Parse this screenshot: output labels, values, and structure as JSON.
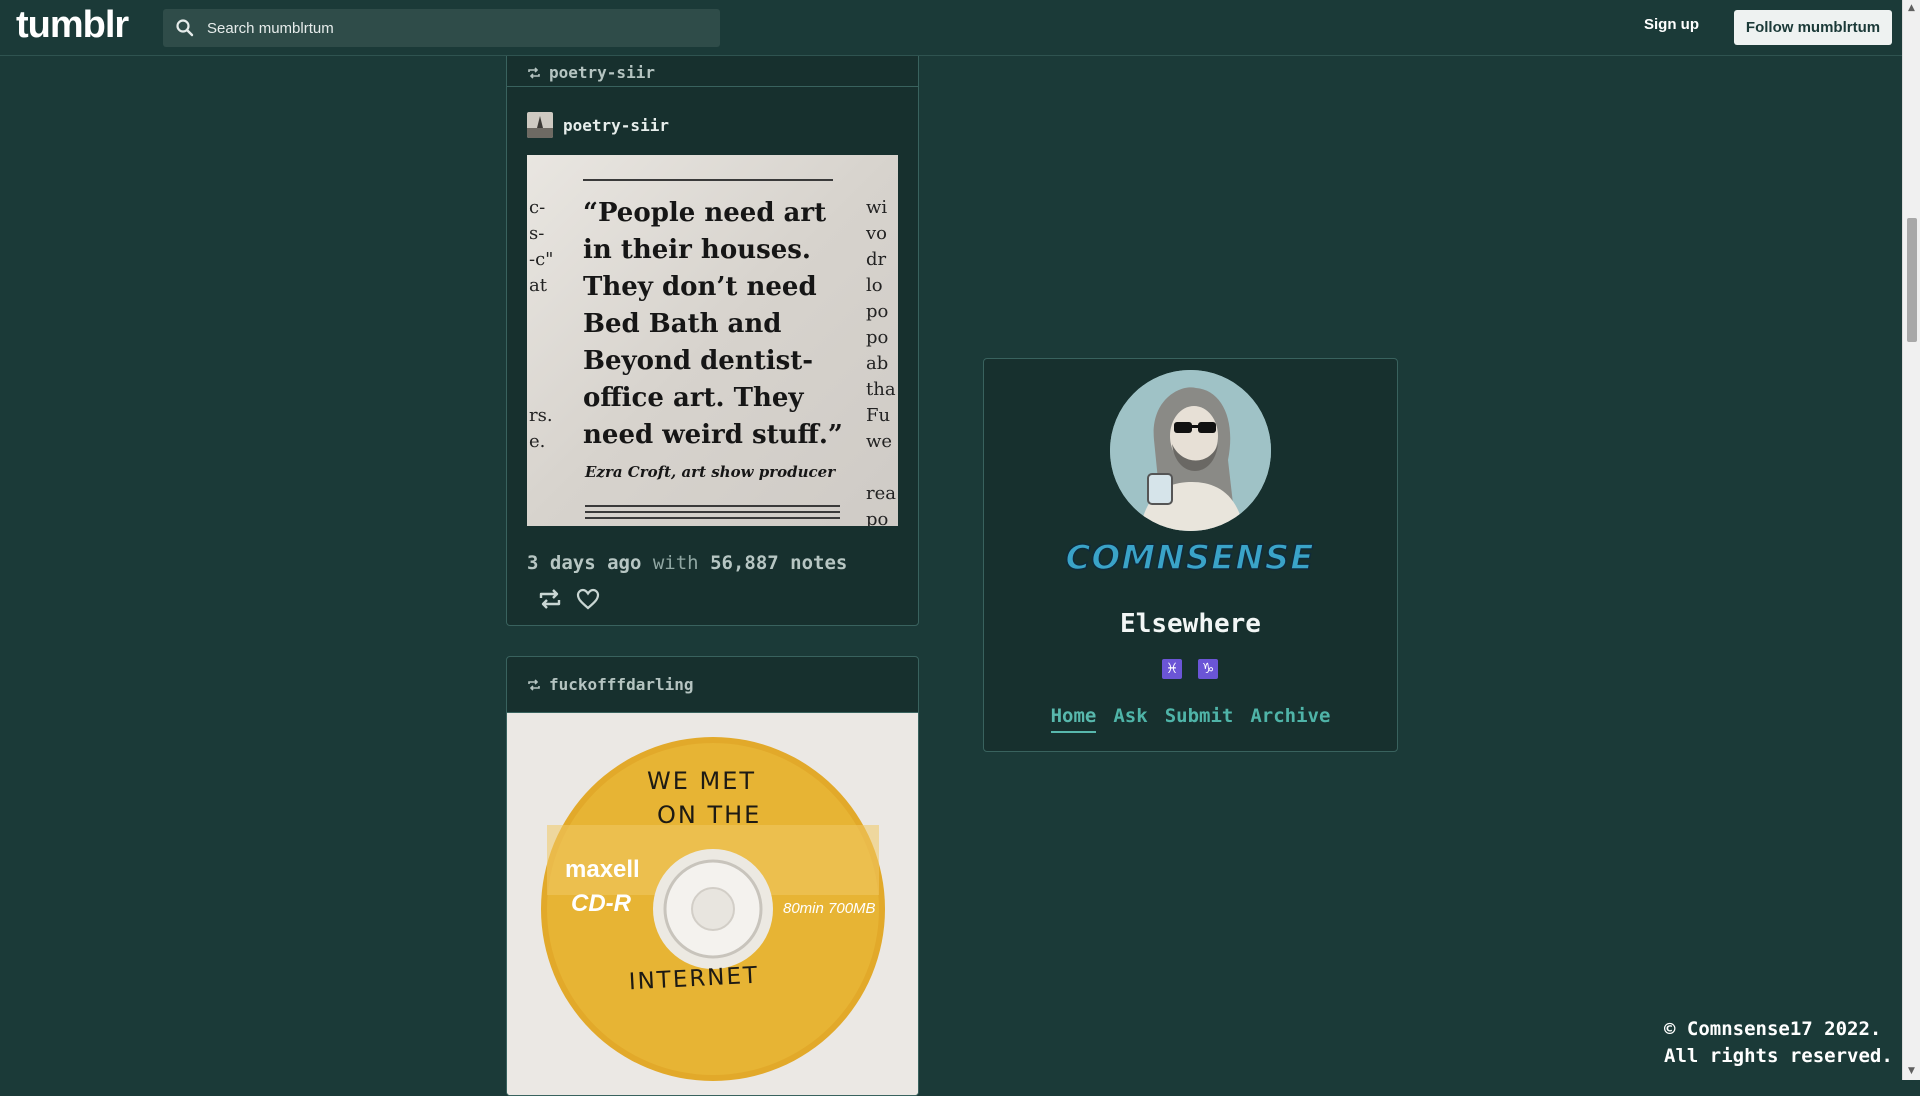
{
  "topbar": {
    "logo": "tumblr",
    "search_placeholder": "Search mumblrtum",
    "signup_label": "Sign up",
    "follow_label": "Follow mumblrtum"
  },
  "posts": [
    {
      "reblogged_from": "poetry-siir",
      "author": "poetry-siir",
      "image": {
        "quote": "“People need art in their houses. They don’t need Bed Bath and Beyond dentist-office art. They need weird stuff.”",
        "credit": "Ezra Croft, art show producer",
        "side_left": [
          "c-",
          "s-",
          "-c\"",
          "at",
          "",
          "",
          "",
          "",
          "rs.",
          "e."
        ],
        "side_right": [
          "wi",
          "vo",
          "dr",
          "lo",
          "po",
          "po",
          "ab",
          "tha",
          "Fu",
          "we",
          "",
          "rea",
          "po"
        ]
      },
      "time": "3 days ago",
      "with_label": "with",
      "notes": "56,887 notes"
    },
    {
      "reblogged_from": "fuckofffdarling",
      "image": {
        "line1": "WE   MET",
        "line2": "ON THE",
        "line3": "INTERNET",
        "brand": "maxell",
        "type": "CD-R",
        "capacity": "80min 700MB"
      }
    }
  ],
  "profile": {
    "brand_text": "COMNSENSE",
    "title": "Elsewhere",
    "badges": [
      "♓",
      "♑"
    ],
    "nav": [
      "Home",
      "Ask",
      "Submit",
      "Archive"
    ]
  },
  "footer": {
    "copyright": "© Comnsense17 2022.\nAll rights reserved."
  },
  "colors": {
    "background": "#1b3a38",
    "card": "#17302e",
    "link": "#4fb4a8",
    "badge": "#6b55d6"
  }
}
